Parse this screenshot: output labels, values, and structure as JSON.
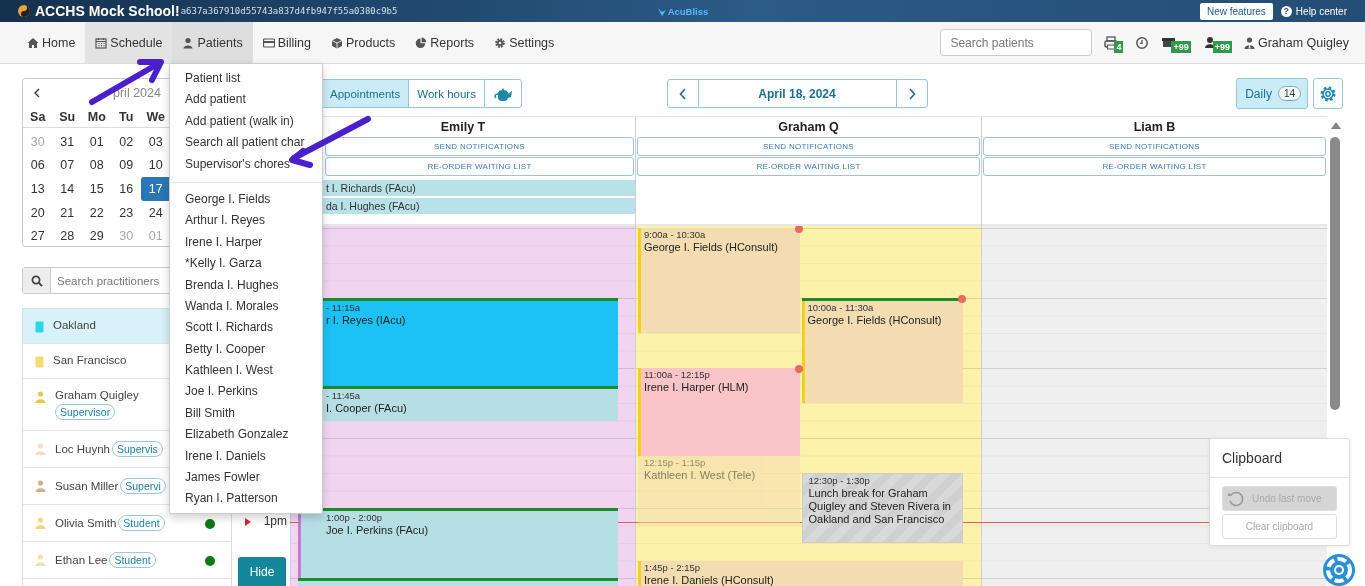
{
  "app_bar": {
    "school": "ACCHS Mock School!",
    "hash": "a637a367910d55743a837d4fb947f55a0380c9b5",
    "brand": "AcuBliss",
    "new_features": "New features",
    "help_glyph": "?",
    "help": "Help center"
  },
  "nav": {
    "items": [
      {
        "label": "Home",
        "selected": false,
        "expanded": false
      },
      {
        "label": "Schedule",
        "selected": true,
        "expanded": false
      },
      {
        "label": "Patients",
        "selected": false,
        "expanded": true
      },
      {
        "label": "Billing",
        "selected": false,
        "expanded": false
      },
      {
        "label": "Products",
        "selected": false,
        "expanded": false
      },
      {
        "label": "Reports",
        "selected": false,
        "expanded": false
      },
      {
        "label": "Settings",
        "selected": false,
        "expanded": false
      }
    ],
    "search": {
      "placeholder": "Search patients"
    },
    "indicators": [
      {
        "kind": "printer",
        "badge": "4"
      },
      {
        "kind": "clock"
      },
      {
        "kind": "tray",
        "badge": "+99"
      },
      {
        "kind": "person",
        "badge": "+99"
      }
    ],
    "user": "Graham Quigley"
  },
  "mini_calendar": {
    "month": "pril 2024",
    "weekdays": [
      "Sa",
      "Su",
      "Mo",
      "Tu",
      "We"
    ],
    "weeks": [
      [
        {
          "day": "30",
          "muted": true,
          "selected": false
        },
        {
          "day": "31",
          "muted": false,
          "selected": false
        },
        {
          "day": "01",
          "muted": false,
          "selected": false
        },
        {
          "day": "02",
          "muted": false,
          "selected": false
        },
        {
          "day": "03",
          "muted": false,
          "selected": false
        }
      ],
      [
        {
          "day": "06",
          "muted": false,
          "selected": false
        },
        {
          "day": "07",
          "muted": false,
          "selected": false
        },
        {
          "day": "08",
          "muted": false,
          "selected": false
        },
        {
          "day": "09",
          "muted": false,
          "selected": false
        },
        {
          "day": "10",
          "muted": false,
          "selected": false
        }
      ],
      [
        {
          "day": "13",
          "muted": false,
          "selected": false
        },
        {
          "day": "14",
          "muted": false,
          "selected": false
        },
        {
          "day": "15",
          "muted": false,
          "selected": false
        },
        {
          "day": "16",
          "muted": false,
          "selected": false
        },
        {
          "day": "17",
          "muted": false,
          "selected": true
        }
      ],
      [
        {
          "day": "20",
          "muted": false,
          "selected": false
        },
        {
          "day": "21",
          "muted": false,
          "selected": false
        },
        {
          "day": "22",
          "muted": false,
          "selected": false
        },
        {
          "day": "23",
          "muted": false,
          "selected": false
        },
        {
          "day": "24",
          "muted": false,
          "selected": false
        }
      ],
      [
        {
          "day": "27",
          "muted": false,
          "selected": false
        },
        {
          "day": "28",
          "muted": false,
          "selected": false
        },
        {
          "day": "29",
          "muted": false,
          "selected": false
        },
        {
          "day": "30",
          "muted": true,
          "selected": false
        },
        {
          "day": "01",
          "muted": true,
          "selected": false
        }
      ]
    ]
  },
  "practitioner_search": {
    "placeholder": "Search practitioners"
  },
  "practitioners": [
    {
      "name": "Oakland",
      "kind": "location",
      "color": "#2fd6ea",
      "selected": true,
      "online": false
    },
    {
      "name": "San Francisco",
      "kind": "location",
      "color": "#f3dc78",
      "selected": false,
      "online": false
    },
    {
      "name": "Graham Quigley",
      "kind": "person",
      "color": "#f0c64a",
      "badge": "Supervisor",
      "selected": false,
      "online": false
    },
    {
      "name": "Loc Huynh",
      "kind": "person",
      "color": "#f7dcc6",
      "badge": "Supervis",
      "selected": false,
      "online": false
    },
    {
      "name": "Susan Miller",
      "kind": "person",
      "color": "#d6b08c",
      "badge": "Supervi",
      "selected": false,
      "online": false
    },
    {
      "name": "Olivia Smith",
      "kind": "person",
      "color": "#f3d77c",
      "badge": "Student",
      "selected": false,
      "online": true
    },
    {
      "name": "Ethan Lee",
      "kind": "person",
      "color": "#f7dfb4",
      "badge": "Student",
      "selected": false,
      "online": true
    }
  ],
  "toolbar": {
    "views": [
      {
        "label": "Appointments",
        "selected": true
      },
      {
        "label": "Work hours",
        "selected": false
      }
    ],
    "date": "April 18, 2024",
    "mode": {
      "label": "Daily",
      "count": "14",
      "selected": true
    }
  },
  "columns": [
    {
      "name": "Emily T",
      "color": "#f1d5f0",
      "actions": [
        "SEND NOTIFICATIONS",
        "RE-ORDER WAITING LIST"
      ],
      "waiting": [
        "t I. Richards (FAcu)",
        "da I. Hughes (FAcu)"
      ],
      "events": [
        {
          "kind": "appointment",
          "time": "- 11:15a",
          "title": "r I. Reyes (IAcu)",
          "color": "#1cc1f6",
          "arrived": true,
          "alert": false,
          "dimmed": false
        },
        {
          "kind": "appointment",
          "time": "- 11:45a",
          "title": "I. Cooper (FAcu)",
          "color": "#b6dfe5",
          "arrived": true,
          "alert": false,
          "dimmed": false
        },
        {
          "kind": "appointment",
          "time": "1:00p - 2:00p",
          "title": "Joe I. Perkins (FAcu)",
          "color": "#b6dfe5",
          "stripe": {
            "color": "#c57bd4"
          },
          "arrived": true,
          "alert": false,
          "dimmed": false
        },
        {
          "kind": "appointment",
          "color": "#b6dfe5",
          "arrived": true,
          "alert": false,
          "dimmed": false
        }
      ]
    },
    {
      "name": "Graham Q",
      "color": "#fdf2aa",
      "actions": [
        "SEND NOTIFICATIONS",
        "RE-ORDER WAITING LIST"
      ],
      "events": [
        {
          "kind": "appointment",
          "time": "9:00a - 10:30a",
          "title": "George I. Fields (HConsult)",
          "color": "#f3dcb1",
          "stripe": {
            "color": "#f4cf1c"
          },
          "arrived": false,
          "alert": true,
          "dimmed": false
        },
        {
          "kind": "appointment",
          "time": "10:00a - 11:30a",
          "title": "George I. Fields (HConsult)",
          "color": "#f3dcb1",
          "stripe": {
            "color": "#f4cf1c"
          },
          "arrived": true,
          "alert": true,
          "dimmed": false
        },
        {
          "kind": "appointment",
          "time": "11:00a - 12:15p",
          "title": "Irene I. Harper (HLM)",
          "color": "#f9c4c8",
          "stripe": {
            "color": "#f4cf1c"
          },
          "arrived": false,
          "alert": true,
          "dimmed": false
        },
        {
          "kind": "appointment",
          "time": "12:15p - 1:15p",
          "title": "Kathleen I. West (Tele)",
          "color": "#f3dcb1",
          "arrived": false,
          "alert": false,
          "dimmed": true
        },
        {
          "kind": "break",
          "time": "12:30p - 1:30p",
          "title": "Lunch break for Graham Quigley and Steven Rivera in Oakland and San Francisco"
        },
        {
          "kind": "appointment",
          "time": "1:45p - 2:15p",
          "title": "Irene I. Daniels (HConsult)",
          "color": "#f3dcb1",
          "stripe": {
            "color": "#f4cf1c"
          },
          "arrived": false,
          "alert": false,
          "dimmed": false
        }
      ]
    },
    {
      "name": "Liam B",
      "color": "#efefef",
      "actions": [
        "SEND NOTIFICATIONS",
        "RE-ORDER WAITING LIST"
      ]
    }
  ],
  "time_labels": [
    {
      "label": "1pm"
    }
  ],
  "hide_button": "Hide",
  "clipboard": {
    "title": "Clipboard",
    "buttons": [
      {
        "label": "Undo last move",
        "disabled": true
      },
      {
        "label": "Clear clipboard",
        "disabled": true
      }
    ]
  },
  "patients_menu": {
    "actions": [
      "Patient list",
      "Add patient",
      "Add patient (walk in)",
      "Search all patient char",
      "Supervisor's chores"
    ],
    "patients": [
      "George I. Fields",
      "Arthur I. Reyes",
      "Irene I. Harper",
      "*Kelly I. Garza",
      "Brenda I. Hughes",
      "Wanda I. Morales",
      "Scott I. Richards",
      "Betty I. Cooper",
      "Kathleen I. West",
      "Joe I. Perkins",
      "Bill Smith",
      "Elizabeth Gonzalez",
      "Irene I. Daniels",
      "James Fowler",
      "Ryan I. Patterson"
    ]
  }
}
